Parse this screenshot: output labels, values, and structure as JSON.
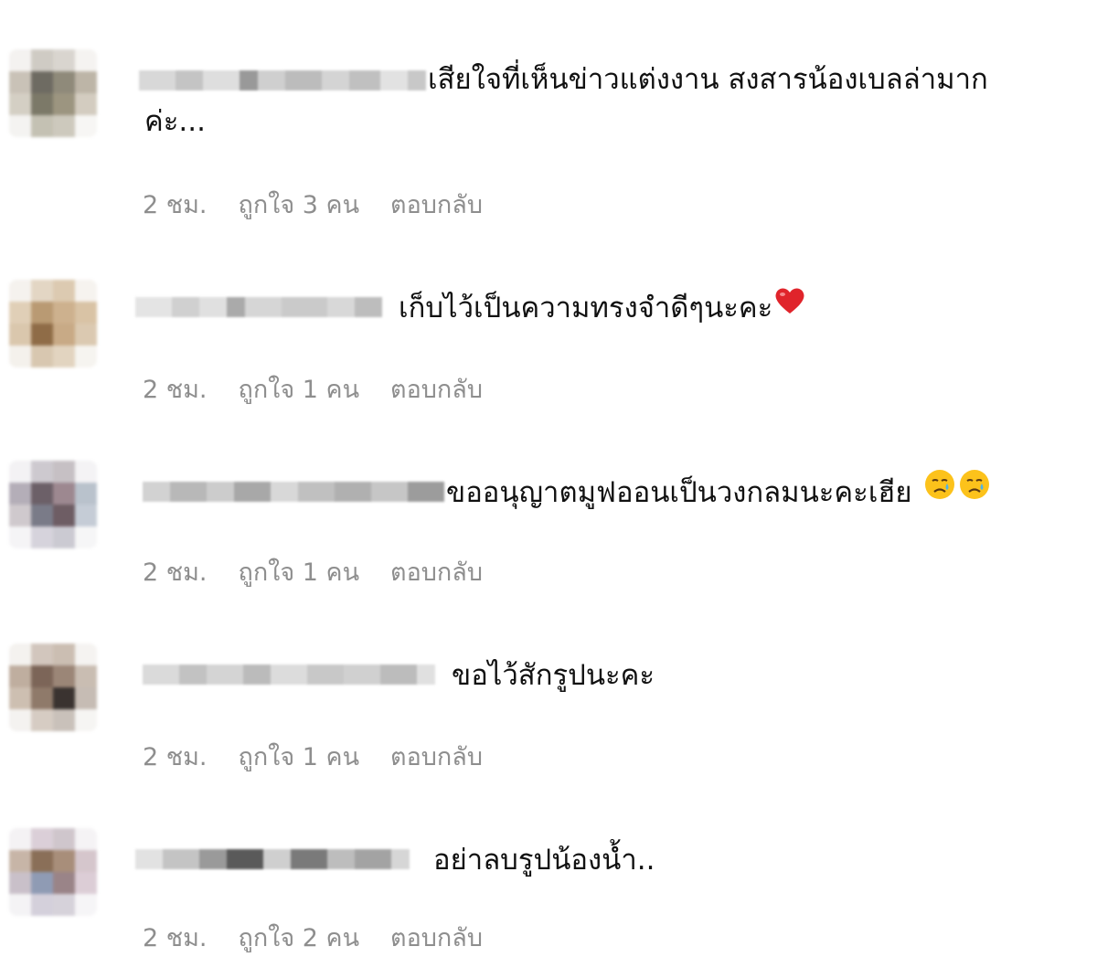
{
  "comments": [
    {
      "text": "เสียใจที่เห็นข่าวแต่งงาน สงสารน้องเบลล่ามาก",
      "text_cont": "ค่ะ...",
      "time": "2 ชม.",
      "likes": "ถูกใจ 3 คน",
      "reply": "ตอบกลับ",
      "emojis": []
    },
    {
      "text": "เก็บไว้เป็นความทรงจำดีๆนะคะ",
      "time": "2 ชม.",
      "likes": "ถูกใจ 1 คน",
      "reply": "ตอบกลับ",
      "emojis": [
        "red-heart"
      ]
    },
    {
      "text": "ขออนุญาตมูฟออนเป็นวงกลมนะคะเฮีย",
      "time": "2 ชม.",
      "likes": "ถูกใจ 1 คน",
      "reply": "ตอบกลับ",
      "emojis": [
        "crying-face",
        "crying-face"
      ]
    },
    {
      "text": "ขอไว้สักรูปนะคะ",
      "time": "2 ชม.",
      "likes": "ถูกใจ 1 คน",
      "reply": "ตอบกลับ",
      "emojis": []
    },
    {
      "text": "อย่าลบรูปน้องน้ำ..",
      "time": "2 ชม.",
      "likes": "ถูกใจ 2 คน",
      "reply": "ตอบกลับ",
      "emojis": []
    }
  ]
}
